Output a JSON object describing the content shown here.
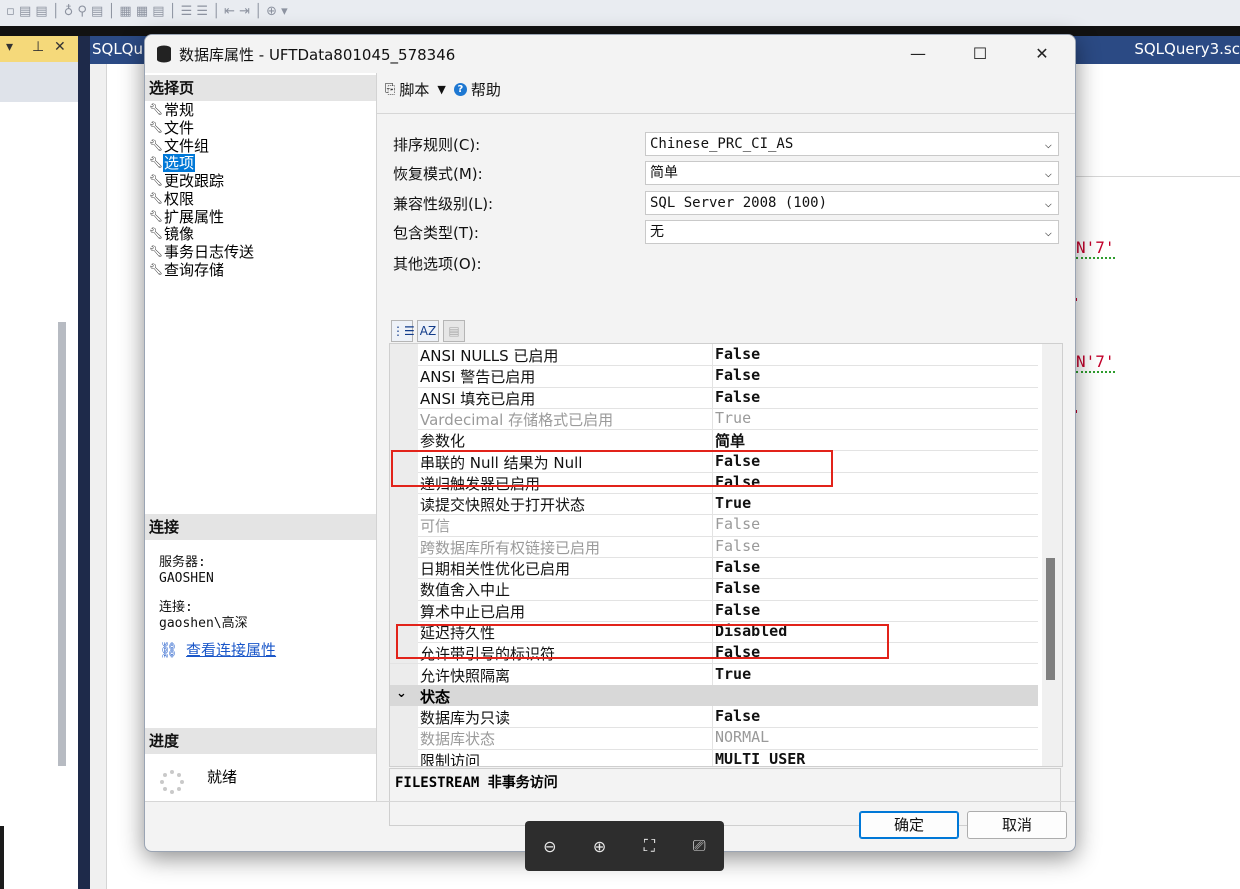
{
  "ide": {
    "left_tab": "SQLQu",
    "right_tab": "SQLQuery3.sc",
    "code_fragment": "N'7'",
    "code_fragment_2": "N'7'"
  },
  "dialog": {
    "title": "数据库属性 - UFTData801045_578346",
    "minimize": "—",
    "maximize": "☐",
    "close": "✕"
  },
  "left": {
    "select_page_header": "选择页",
    "pages": [
      {
        "label": "常规",
        "selected": false
      },
      {
        "label": "文件",
        "selected": false
      },
      {
        "label": "文件组",
        "selected": false
      },
      {
        "label": "选项",
        "selected": true
      },
      {
        "label": "更改跟踪",
        "selected": false
      },
      {
        "label": "权限",
        "selected": false
      },
      {
        "label": "扩展属性",
        "selected": false
      },
      {
        "label": "镜像",
        "selected": false
      },
      {
        "label": "事务日志传送",
        "selected": false
      },
      {
        "label": "查询存储",
        "selected": false
      }
    ],
    "connection_header": "连接",
    "server_label": "服务器:",
    "server_value": "GAOSHEN",
    "connection_label": "连接:",
    "connection_value": "gaoshen\\高深",
    "view_link": "查看连接属性",
    "progress_header": "进度",
    "progress_status": "就绪"
  },
  "toolbar": {
    "script_label": "脚本",
    "help_label": "帮助"
  },
  "form": {
    "collation_label": "排序规则(C):",
    "collation_value": "Chinese_PRC_CI_AS",
    "recovery_label": "恢复模式(M):",
    "recovery_value": "简单",
    "compat_label": "兼容性级别(L):",
    "compat_value": "SQL Server 2008 (100)",
    "containment_label": "包含类型(T):",
    "containment_value": "无",
    "other_label": "其他选项(O):"
  },
  "properties": [
    {
      "name": "ANSI NULLS 已启用",
      "value": "False",
      "disabled": false
    },
    {
      "name": "ANSI 警告已启用",
      "value": "False",
      "disabled": false
    },
    {
      "name": "ANSI 填充已启用",
      "value": "False",
      "disabled": false
    },
    {
      "name": "Vardecimal 存储格式已启用",
      "value": "True",
      "disabled": true
    },
    {
      "name": "参数化",
      "value": "简单",
      "disabled": false
    },
    {
      "name": "串联的 Null 结果为 Null",
      "value": "False",
      "disabled": false
    },
    {
      "name": "递归触发器已启用",
      "value": "False",
      "disabled": false
    },
    {
      "name": "读提交快照处于打开状态",
      "value": "True",
      "disabled": false
    },
    {
      "name": "可信",
      "value": "False",
      "disabled": true
    },
    {
      "name": "跨数据库所有权链接已启用",
      "value": "False",
      "disabled": true
    },
    {
      "name": "日期相关性优化已启用",
      "value": "False",
      "disabled": false
    },
    {
      "name": "数值舍入中止",
      "value": "False",
      "disabled": false
    },
    {
      "name": "算术中止已启用",
      "value": "False",
      "disabled": false
    },
    {
      "name": "延迟持久性",
      "value": "Disabled",
      "disabled": false
    },
    {
      "name": "允许带引号的标识符",
      "value": "False",
      "disabled": false
    },
    {
      "name": "允许快照隔离",
      "value": "True",
      "disabled": false
    }
  ],
  "state_category": "状态",
  "state_properties": [
    {
      "name": "数据库为只读",
      "value": "False",
      "disabled": false
    },
    {
      "name": "数据库状态",
      "value": "NORMAL",
      "disabled": true
    },
    {
      "name": "限制访问",
      "value": "MULTI_USER",
      "disabled": false
    }
  ],
  "description": "FILESTREAM 非事务访问",
  "buttons": {
    "ok": "确定",
    "cancel": "取消"
  },
  "viewer": {
    "zoom_out_icon": "zoom-out-icon",
    "zoom_in_icon": "zoom-in-icon",
    "fit_icon": "fit-screen-icon",
    "present_icon": "present-icon"
  }
}
